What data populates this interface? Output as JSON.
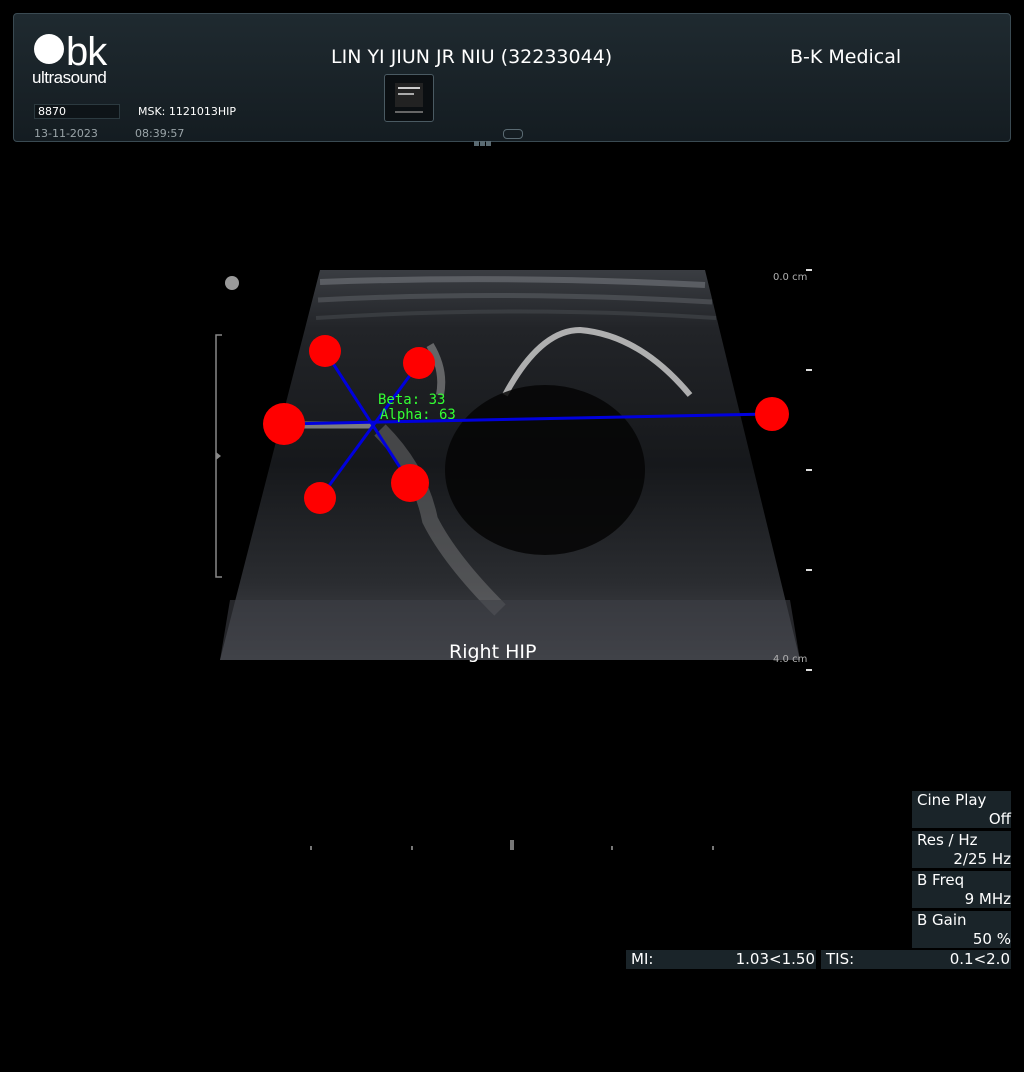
{
  "header": {
    "logo_main": "bk",
    "logo_sub": "ultrasound",
    "patient": "LIN YI JIUN JR NIU (32233044)",
    "hospital": "B-K Medical",
    "id_field": "8870",
    "study": "MSK: 1121013HIP",
    "date": "13-11-2023",
    "time": "08:39:57"
  },
  "image": {
    "depth_top": "0.0 cm",
    "depth_bottom": "4.0 cm",
    "body_label": "Right HIP",
    "beta_label": "Beta: 33",
    "alpha_label": "Alpha: 63",
    "marker_color": "#ff0000",
    "line_color": "#0000dd",
    "text_color": "#33ff33"
  },
  "controls": [
    {
      "label": "Cine Play",
      "value": "Off"
    },
    {
      "label": "Res / Hz",
      "value": "2/25 Hz"
    },
    {
      "label": "B Freq",
      "value": "9 MHz"
    },
    {
      "label": "B Gain",
      "value": "50 %"
    }
  ],
  "safety": {
    "mi_label": "MI:",
    "mi_value": "1.03<1.50",
    "tis_label": "TIS:",
    "tis_value": "0.1<2.0"
  }
}
